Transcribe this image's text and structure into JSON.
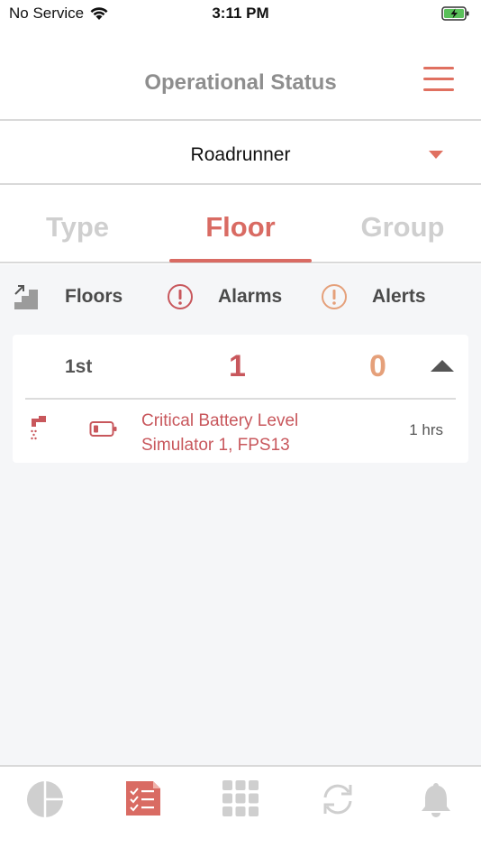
{
  "status_bar": {
    "carrier": "No Service",
    "time": "3:11 PM"
  },
  "header": {
    "title": "Operational Status",
    "menu_icon": "hamburger-menu-icon"
  },
  "site_selector": {
    "value": "Roadrunner"
  },
  "tabs": [
    {
      "label": "Type",
      "active": false
    },
    {
      "label": "Floor",
      "active": true
    },
    {
      "label": "Group",
      "active": false
    }
  ],
  "legend": {
    "floors_label": "Floors",
    "alarms_label": "Alarms",
    "alerts_label": "Alerts"
  },
  "floors": [
    {
      "name": "1st",
      "alarms": "1",
      "alerts": "0",
      "expanded": true,
      "items": [
        {
          "title": "Critical Battery Level",
          "subtitle": "Simulator 1, FPS13",
          "time": "1 hrs"
        }
      ]
    }
  ],
  "colors": {
    "accent": "#d96b63",
    "alarm": "#c8575c",
    "alert": "#e5a07a",
    "inactive": "#cfcfcf"
  },
  "bottom_nav": [
    {
      "icon": "pie-chart-icon",
      "active": false
    },
    {
      "icon": "checklist-icon",
      "active": true
    },
    {
      "icon": "grid-icon",
      "active": false
    },
    {
      "icon": "sync-icon",
      "active": false
    },
    {
      "icon": "bell-icon",
      "active": false
    }
  ]
}
